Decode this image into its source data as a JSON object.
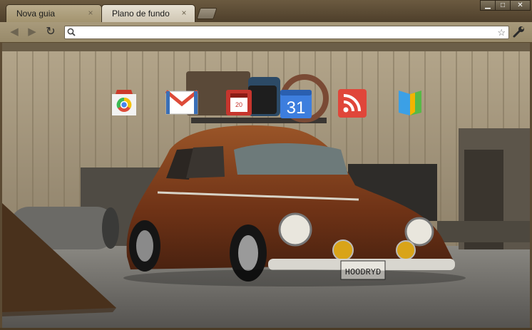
{
  "tabs": [
    {
      "label": "Nova guia",
      "close": "×"
    },
    {
      "label": "Plano de fundo",
      "close": "×"
    }
  ],
  "window_controls": {
    "minimize": "▁",
    "maximize": "□",
    "close": "✕"
  },
  "toolbar": {
    "back": "◀",
    "forward": "▶",
    "reload": "↻",
    "address_value": "",
    "star": "☆"
  },
  "apps": [
    {
      "name": "Chrome Web Store",
      "icon": "web-store-icon"
    },
    {
      "name": "Gmail",
      "icon": "gmail-icon"
    },
    {
      "name": "Google Books",
      "icon": "books-icon",
      "text": "20"
    },
    {
      "name": "Google Calendar",
      "icon": "calendar-icon",
      "text": "31"
    },
    {
      "name": "Google Reader",
      "icon": "rss-icon"
    },
    {
      "name": "Google Livros",
      "icon": "open-book-icon"
    }
  ],
  "wallpaper": {
    "license_plate": "HOODRYD",
    "colors": {
      "car_rust": "#7a3a18",
      "wall": "#a8997f",
      "ground": "#6f6d68",
      "frame": "#5b4a33"
    }
  }
}
